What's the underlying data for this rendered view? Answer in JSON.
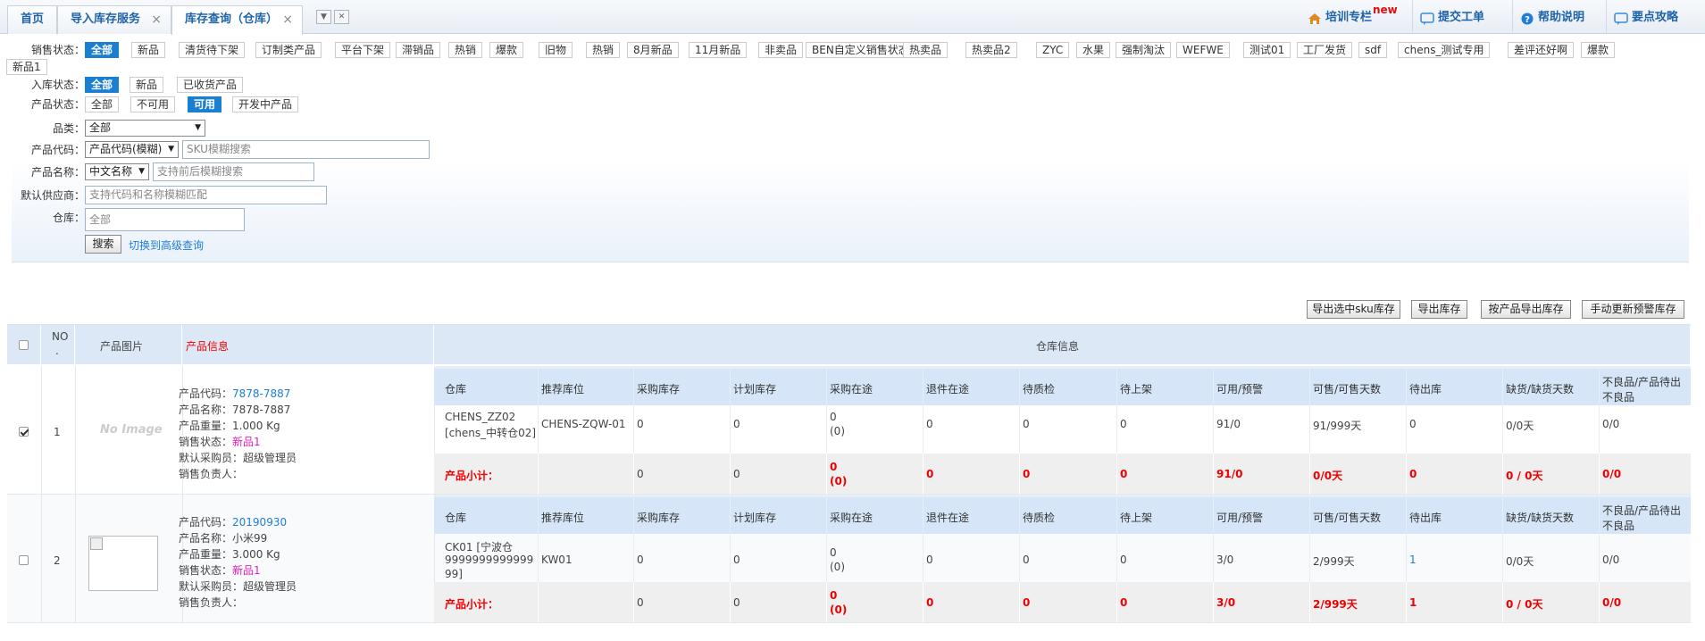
{
  "tabs": [
    {
      "label": "首页"
    },
    {
      "label": "导入库存服务"
    },
    {
      "label": "库存查询（仓库）"
    }
  ],
  "topright": [
    {
      "label": "培训专栏"
    },
    {
      "label": "提交工单"
    },
    {
      "label": "帮助说明"
    },
    {
      "label": "要点攻略"
    }
  ],
  "new_badge": "new",
  "filter": {
    "sale_status_label": "销售状态：",
    "sale_status_options": [
      "全部",
      "新品",
      "清货待下架",
      "订制类产品",
      "平台下架",
      "滞销品",
      "热销",
      "爆款",
      "旧物",
      "热销",
      "8月新品",
      "11月新品",
      "非卖品",
      "BEN自定义销售状态",
      "热卖品",
      "热卖品2",
      "ZYC",
      "水果",
      "强制淘汰",
      "WEFWE",
      "测试01",
      "工厂发货",
      "sdf",
      "chens_测试专用",
      "差评还好啊",
      "爆款",
      "新品1"
    ],
    "in_status_label": "入库状态：",
    "in_status_options": [
      "全部",
      "新品",
      "已收货产品"
    ],
    "prod_status_label": "产品状态：",
    "prod_status_options": [
      "全部",
      "不可用",
      "可用",
      "开发中产品"
    ],
    "category_label": "品类：",
    "category_value": "全部",
    "code_label": "产品代码：",
    "code_mode": "产品代码(模糊)",
    "code_placeholder": "SKU模糊搜索",
    "name_label": "产品名称：",
    "name_mode": "中文名称",
    "name_placeholder": "支持前后模糊搜索",
    "supplier_label": "默认供应商：",
    "supplier_placeholder": "支持代码和名称模糊匹配",
    "warehouse_label": "仓库：",
    "warehouse_placeholder": "全部",
    "search_btn": "搜索",
    "advanced_link": "切换到高级查询"
  },
  "actions": [
    "导出选中sku库存",
    "导出库存",
    "按产品导出库存",
    "手动更新预警库存"
  ],
  "table": {
    "headers": {
      "no": "NO",
      "dot": ".",
      "image": "产品图片",
      "info": "产品信息",
      "wh": "仓库信息"
    },
    "sub_headers": [
      "仓库",
      "推荐库位",
      "采购库存",
      "计划库存",
      "采购在途",
      "退件在途",
      "待质检",
      "待上架",
      "可用/预警",
      "可售/可售天数",
      "待出库",
      "缺货/缺货天数",
      "不良品/产品待出",
      "不良品"
    ],
    "subtotal_label": "产品小计：",
    "no_image_text": "No Image",
    "rows": [
      {
        "no": "1",
        "checked": true,
        "code_label": "产品代码：",
        "code": "7878-7887",
        "name": "产品名称：7878-7887",
        "weight": "产品重量：1.000 Kg",
        "status_label": "销售状态：",
        "status": "新品1",
        "buyer": "默认采购员：超级管理员",
        "seller": "销售负责人：",
        "wh": [
          "CHENS_ZZ02",
          "[chens_中转仓02]"
        ],
        "loc": "CHENS-ZQW-01",
        "vals": [
          "0",
          "0"
        ],
        "transit": [
          "0",
          "(0)"
        ],
        "vals2": [
          "0",
          "0",
          "0",
          "91/0",
          "91/999天",
          "0",
          "0/0天",
          "0/0"
        ],
        "sub": [
          "0",
          "0"
        ],
        "sub_transit": [
          "0",
          "(0)"
        ],
        "sub2": [
          "0",
          "0",
          "0",
          "91/0",
          "0/0天",
          "0",
          "0 / 0天",
          "0/0"
        ]
      },
      {
        "no": "2",
        "checked": false,
        "code_label": "产品代码：",
        "code": "20190930",
        "name": "产品名称：小米99",
        "weight": "产品重量：3.000 Kg",
        "status_label": "销售状态：",
        "status": "新品1",
        "buyer": "默认采购员：超级管理员",
        "seller": "销售负责人：",
        "wh": [
          "CK01 [宁波仓",
          "9999999999999",
          "99]"
        ],
        "loc": "KW01",
        "vals": [
          "0",
          "0"
        ],
        "transit": [
          "0",
          "(0)"
        ],
        "vals2": [
          "0",
          "0",
          "0",
          "3/0",
          "2/999天",
          "1",
          "0/0天",
          "0/0"
        ],
        "sub": [
          "0",
          "0"
        ],
        "sub_transit": [
          "0",
          "(0)"
        ],
        "sub2": [
          "0",
          "0",
          "0",
          "3/0",
          "2/999天",
          "1",
          "0 / 0天",
          "0/0"
        ]
      }
    ]
  }
}
